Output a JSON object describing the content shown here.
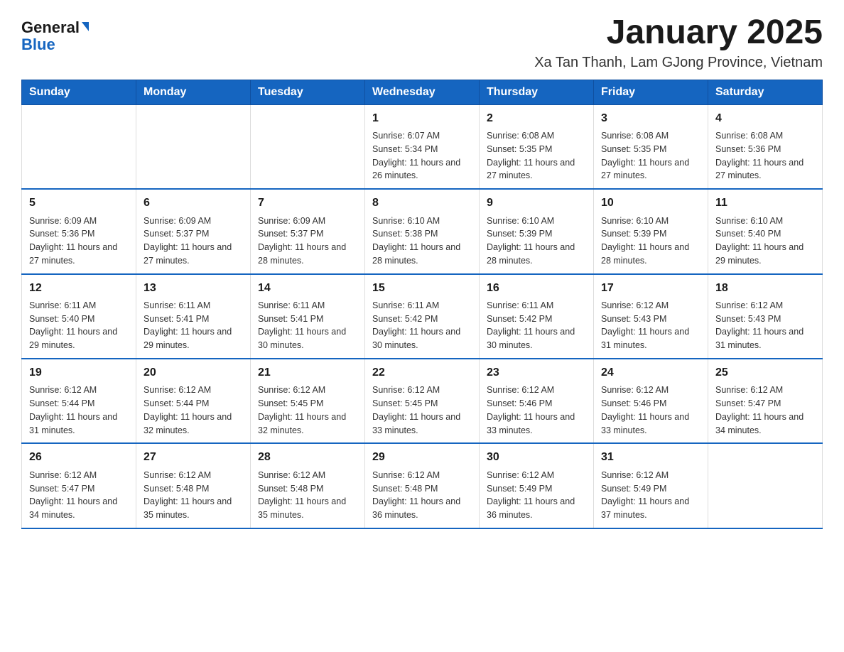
{
  "logo": {
    "general": "General",
    "blue": "Blue"
  },
  "title": "January 2025",
  "subtitle": "Xa Tan Thanh, Lam GJong Province, Vietnam",
  "days_of_week": [
    "Sunday",
    "Monday",
    "Tuesday",
    "Wednesday",
    "Thursday",
    "Friday",
    "Saturday"
  ],
  "weeks": [
    [
      {
        "day": "",
        "info": ""
      },
      {
        "day": "",
        "info": ""
      },
      {
        "day": "",
        "info": ""
      },
      {
        "day": "1",
        "info": "Sunrise: 6:07 AM\nSunset: 5:34 PM\nDaylight: 11 hours and 26 minutes."
      },
      {
        "day": "2",
        "info": "Sunrise: 6:08 AM\nSunset: 5:35 PM\nDaylight: 11 hours and 27 minutes."
      },
      {
        "day": "3",
        "info": "Sunrise: 6:08 AM\nSunset: 5:35 PM\nDaylight: 11 hours and 27 minutes."
      },
      {
        "day": "4",
        "info": "Sunrise: 6:08 AM\nSunset: 5:36 PM\nDaylight: 11 hours and 27 minutes."
      }
    ],
    [
      {
        "day": "5",
        "info": "Sunrise: 6:09 AM\nSunset: 5:36 PM\nDaylight: 11 hours and 27 minutes."
      },
      {
        "day": "6",
        "info": "Sunrise: 6:09 AM\nSunset: 5:37 PM\nDaylight: 11 hours and 27 minutes."
      },
      {
        "day": "7",
        "info": "Sunrise: 6:09 AM\nSunset: 5:37 PM\nDaylight: 11 hours and 28 minutes."
      },
      {
        "day": "8",
        "info": "Sunrise: 6:10 AM\nSunset: 5:38 PM\nDaylight: 11 hours and 28 minutes."
      },
      {
        "day": "9",
        "info": "Sunrise: 6:10 AM\nSunset: 5:39 PM\nDaylight: 11 hours and 28 minutes."
      },
      {
        "day": "10",
        "info": "Sunrise: 6:10 AM\nSunset: 5:39 PM\nDaylight: 11 hours and 28 minutes."
      },
      {
        "day": "11",
        "info": "Sunrise: 6:10 AM\nSunset: 5:40 PM\nDaylight: 11 hours and 29 minutes."
      }
    ],
    [
      {
        "day": "12",
        "info": "Sunrise: 6:11 AM\nSunset: 5:40 PM\nDaylight: 11 hours and 29 minutes."
      },
      {
        "day": "13",
        "info": "Sunrise: 6:11 AM\nSunset: 5:41 PM\nDaylight: 11 hours and 29 minutes."
      },
      {
        "day": "14",
        "info": "Sunrise: 6:11 AM\nSunset: 5:41 PM\nDaylight: 11 hours and 30 minutes."
      },
      {
        "day": "15",
        "info": "Sunrise: 6:11 AM\nSunset: 5:42 PM\nDaylight: 11 hours and 30 minutes."
      },
      {
        "day": "16",
        "info": "Sunrise: 6:11 AM\nSunset: 5:42 PM\nDaylight: 11 hours and 30 minutes."
      },
      {
        "day": "17",
        "info": "Sunrise: 6:12 AM\nSunset: 5:43 PM\nDaylight: 11 hours and 31 minutes."
      },
      {
        "day": "18",
        "info": "Sunrise: 6:12 AM\nSunset: 5:43 PM\nDaylight: 11 hours and 31 minutes."
      }
    ],
    [
      {
        "day": "19",
        "info": "Sunrise: 6:12 AM\nSunset: 5:44 PM\nDaylight: 11 hours and 31 minutes."
      },
      {
        "day": "20",
        "info": "Sunrise: 6:12 AM\nSunset: 5:44 PM\nDaylight: 11 hours and 32 minutes."
      },
      {
        "day": "21",
        "info": "Sunrise: 6:12 AM\nSunset: 5:45 PM\nDaylight: 11 hours and 32 minutes."
      },
      {
        "day": "22",
        "info": "Sunrise: 6:12 AM\nSunset: 5:45 PM\nDaylight: 11 hours and 33 minutes."
      },
      {
        "day": "23",
        "info": "Sunrise: 6:12 AM\nSunset: 5:46 PM\nDaylight: 11 hours and 33 minutes."
      },
      {
        "day": "24",
        "info": "Sunrise: 6:12 AM\nSunset: 5:46 PM\nDaylight: 11 hours and 33 minutes."
      },
      {
        "day": "25",
        "info": "Sunrise: 6:12 AM\nSunset: 5:47 PM\nDaylight: 11 hours and 34 minutes."
      }
    ],
    [
      {
        "day": "26",
        "info": "Sunrise: 6:12 AM\nSunset: 5:47 PM\nDaylight: 11 hours and 34 minutes."
      },
      {
        "day": "27",
        "info": "Sunrise: 6:12 AM\nSunset: 5:48 PM\nDaylight: 11 hours and 35 minutes."
      },
      {
        "day": "28",
        "info": "Sunrise: 6:12 AM\nSunset: 5:48 PM\nDaylight: 11 hours and 35 minutes."
      },
      {
        "day": "29",
        "info": "Sunrise: 6:12 AM\nSunset: 5:48 PM\nDaylight: 11 hours and 36 minutes."
      },
      {
        "day": "30",
        "info": "Sunrise: 6:12 AM\nSunset: 5:49 PM\nDaylight: 11 hours and 36 minutes."
      },
      {
        "day": "31",
        "info": "Sunrise: 6:12 AM\nSunset: 5:49 PM\nDaylight: 11 hours and 37 minutes."
      },
      {
        "day": "",
        "info": ""
      }
    ]
  ]
}
